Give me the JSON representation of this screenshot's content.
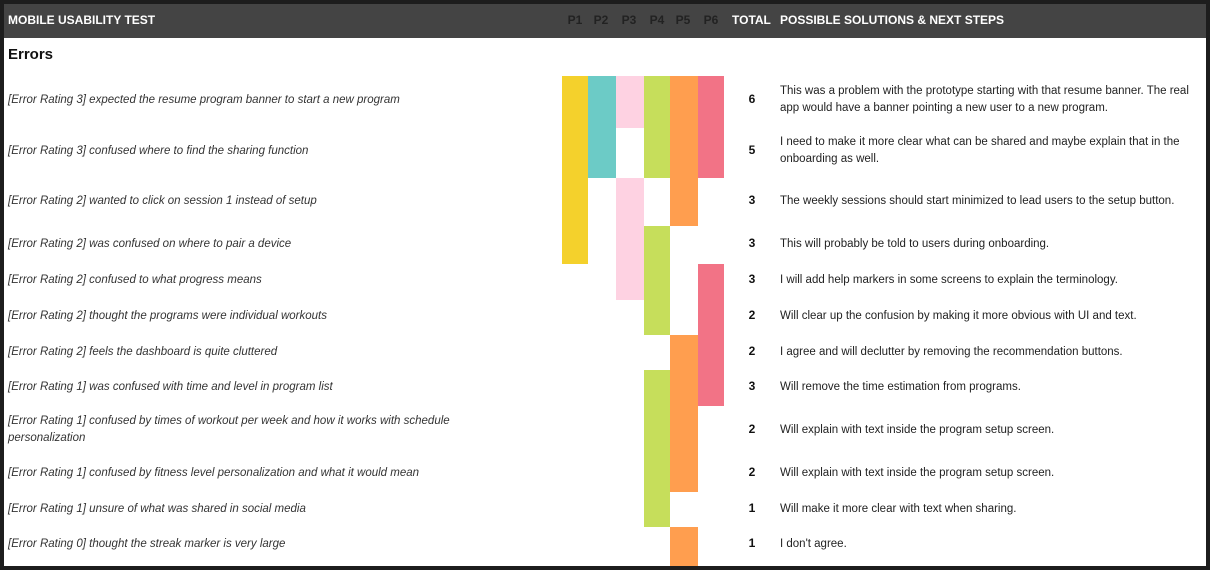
{
  "header": {
    "title": "MOBILE USABILITY TEST",
    "participants": [
      {
        "label": "P1",
        "color": "#F4D12C"
      },
      {
        "label": "P2",
        "color": "#6CCBC6"
      },
      {
        "label": "P3",
        "color": "#FED2E2"
      },
      {
        "label": "P4",
        "color": "#C6DE5B"
      },
      {
        "label": "P5",
        "color": "#FF9E4F"
      },
      {
        "label": "P6",
        "color": "#F27386"
      }
    ],
    "total_label": "TOTAL",
    "solutions_label": "POSSIBLE SOLUTIONS & NEXT STEPS"
  },
  "section_title": "Errors",
  "rows": [
    {
      "error": "[Error Rating 3] expected the resume program banner to start a new program",
      "total": "6",
      "solution": "This was a problem with the prototype starting with that resume banner. The real app would have a banner pointing a new user to a new program.",
      "marks": [
        1,
        1,
        1,
        1,
        1,
        1
      ]
    },
    {
      "error": "[Error Rating 3] confused where to find the sharing function",
      "total": "5",
      "solution": "I need to make it more clear what can be shared and maybe explain that in the onboarding as well.",
      "marks": [
        1,
        1,
        0,
        1,
        1,
        1
      ]
    },
    {
      "error": "[Error Rating 2] wanted to click on session 1 instead of setup",
      "total": "3",
      "solution": "The weekly sessions should start minimized to lead users to the setup button.",
      "marks": [
        1,
        0,
        1,
        0,
        1,
        0
      ]
    },
    {
      "error": "[Error Rating 2] was confused on where to pair a device",
      "total": "3",
      "solution": "This will probably be told to users during onboarding.",
      "marks": [
        1,
        0,
        1,
        1,
        0,
        0
      ]
    },
    {
      "error": "[Error Rating 2] confused to what progress means",
      "total": "3",
      "solution": "I will add help markers in some screens to explain the terminology.",
      "marks": [
        0,
        0,
        1,
        1,
        0,
        1
      ]
    },
    {
      "error": "[Error Rating 2] thought the programs were individual workouts",
      "total": "2",
      "solution": "Will clear up the confusion by making it more obvious with UI and text.",
      "marks": [
        0,
        0,
        0,
        1,
        0,
        1
      ]
    },
    {
      "error": "[Error Rating 2] feels the dashboard is quite cluttered",
      "total": "2",
      "solution": "I agree and will declutter by removing the recommendation buttons.",
      "marks": [
        0,
        0,
        0,
        0,
        1,
        1
      ]
    },
    {
      "error": "[Error Rating 1] was confused with time and level in program list",
      "total": "3",
      "solution": "Will remove the time estimation from programs.",
      "marks": [
        0,
        0,
        0,
        1,
        1,
        1
      ]
    },
    {
      "error": "[Error Rating 1] confused by times of workout per week and how it works with schedule personalization",
      "total": "2",
      "solution": "Will explain with text inside the program setup screen.",
      "marks": [
        0,
        0,
        0,
        1,
        1,
        0
      ]
    },
    {
      "error": "[Error Rating 1] confused by fitness level personalization and what it would mean",
      "total": "2",
      "solution": "Will explain with text inside the program setup screen.",
      "marks": [
        0,
        0,
        0,
        1,
        1,
        0
      ]
    },
    {
      "error": "[Error Rating 1] unsure of what was shared in social media",
      "total": "1",
      "solution": "Will make it more clear with text when sharing.",
      "marks": [
        0,
        0,
        0,
        1,
        0,
        0
      ]
    },
    {
      "error": "[Error Rating 0] thought the streak marker is very large",
      "total": "1",
      "solution": "I don't agree.",
      "marks": [
        0,
        0,
        0,
        0,
        1,
        0
      ]
    }
  ]
}
